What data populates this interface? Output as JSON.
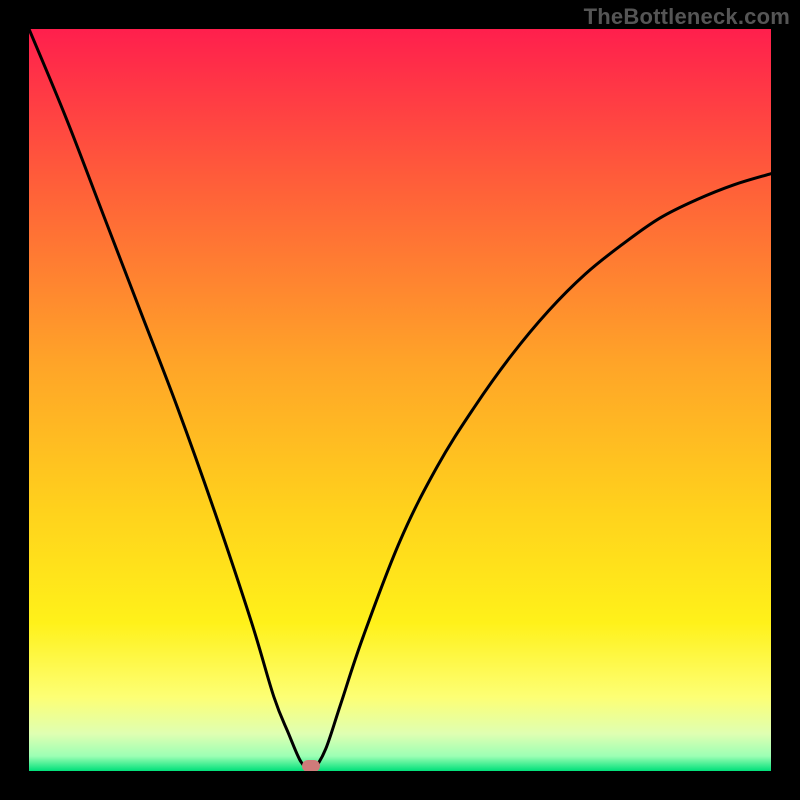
{
  "watermark": "TheBottleneck.com",
  "chart_data": {
    "type": "line",
    "title": "",
    "xlabel": "",
    "ylabel": "",
    "xlim": [
      0,
      100
    ],
    "ylim": [
      0,
      100
    ],
    "grid": false,
    "legend": false,
    "background_gradient_stops": [
      {
        "pos": 0.0,
        "color": "#ff1f4d"
      },
      {
        "pos": 0.2,
        "color": "#ff5c3a"
      },
      {
        "pos": 0.45,
        "color": "#ffa428"
      },
      {
        "pos": 0.65,
        "color": "#ffd21c"
      },
      {
        "pos": 0.8,
        "color": "#fff11a"
      },
      {
        "pos": 0.9,
        "color": "#fdff74"
      },
      {
        "pos": 0.95,
        "color": "#dfffb2"
      },
      {
        "pos": 0.98,
        "color": "#9cffb4"
      },
      {
        "pos": 1.0,
        "color": "#00e07a"
      }
    ],
    "series": [
      {
        "name": "bottleneck-curve",
        "color": "#000000",
        "x": [
          0.0,
          5.0,
          10.0,
          15.0,
          20.0,
          25.0,
          30.0,
          33.0,
          35.0,
          36.5,
          37.5,
          38.0,
          38.5,
          40.0,
          42.0,
          45.0,
          50.0,
          55.0,
          60.0,
          65.0,
          70.0,
          75.0,
          80.0,
          85.0,
          90.0,
          95.0,
          100.0
        ],
        "y": [
          100.0,
          88.0,
          75.0,
          62.0,
          49.0,
          35.0,
          20.0,
          10.0,
          5.0,
          1.5,
          0.3,
          0.0,
          0.3,
          3.0,
          9.0,
          18.0,
          31.0,
          41.0,
          49.0,
          56.0,
          62.0,
          67.0,
          71.0,
          74.5,
          77.0,
          79.0,
          80.5
        ]
      }
    ],
    "marker": {
      "x": 38.0,
      "y": 0.7,
      "color": "#cf7b7a",
      "name": "optimum-marker"
    }
  }
}
